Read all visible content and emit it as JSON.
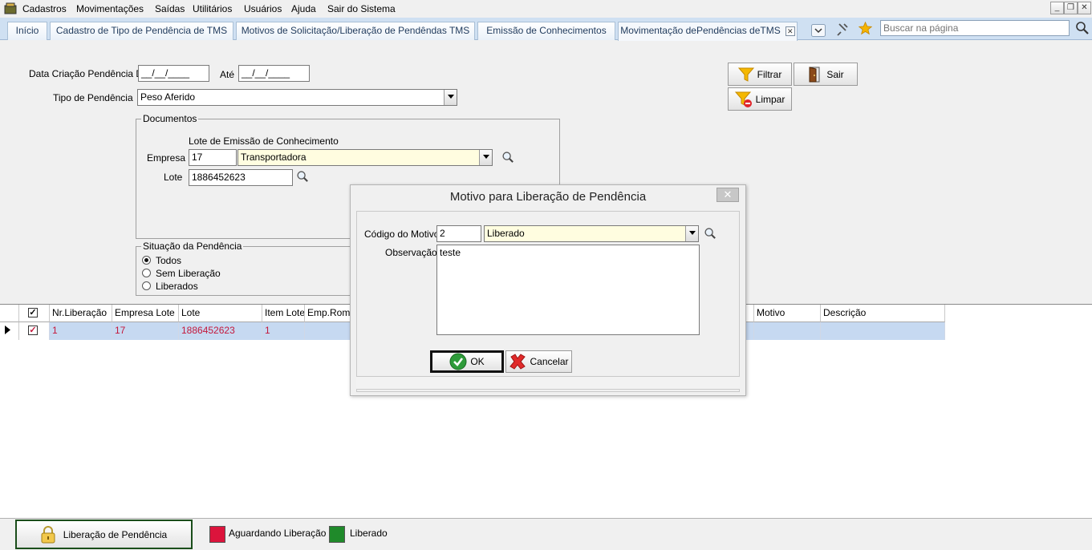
{
  "menu": [
    "Cadastros",
    "Movimentações",
    "Saídas",
    "Utilitários",
    "Usuários",
    "Ajuda",
    "Sair do Sistema"
  ],
  "tabs": [
    {
      "label": "Início"
    },
    {
      "label": "Cadastro de Tipo de Pendência de TMS"
    },
    {
      "label": "Motivos de Solicitação/Liberação de Pendêndas TMS"
    },
    {
      "label": "Emissão de Conhecimentos"
    },
    {
      "label": "Movimentação dePendências deTMS",
      "active": true
    }
  ],
  "search": {
    "placeholder": "Buscar na página"
  },
  "filters": {
    "date_from_label": "Data Criação Pendência De",
    "date_from": "__/__/____",
    "date_to_label": "Até",
    "date_to": "__/__/____",
    "tipo_label": "Tipo de Pendência",
    "tipo_value": "Peso Aferido"
  },
  "documentos": {
    "title": "Documentos",
    "lote_emissao_label": "Lote de Emissão de Conhecimento",
    "empresa_label": "Empresa",
    "empresa_code": "17",
    "empresa_name": "Transportadora",
    "lote_label": "Lote",
    "lote_value": "1886452623"
  },
  "situacao": {
    "title": "Situação da Pendência",
    "options": [
      "Todos",
      "Sem Liberação",
      "Liberados"
    ],
    "selected": "Todos"
  },
  "buttons": {
    "filtrar": "Filtrar",
    "sair": "Sair",
    "limpar": "Limpar"
  },
  "grid": {
    "headers": [
      "Nr.Liberação",
      "Empresa Lote",
      "Lote",
      "Item Lote",
      "Emp.Romar",
      "Motivo",
      "Descrição"
    ],
    "rows": [
      {
        "nr": "1",
        "empresa": "17",
        "lote": "1886452623",
        "item": "1",
        "emp": "",
        "motivo": "",
        "descricao": ""
      }
    ],
    "row_color": "#c4183c"
  },
  "dialog": {
    "title": "Motivo para Liberação de Pendência",
    "codigo_label": "Código do Motivo",
    "codigo_value": "2",
    "motivo_value": "Liberado",
    "obs_label": "Observação",
    "obs_value": "teste",
    "ok": "OK",
    "cancelar": "Cancelar"
  },
  "bottom": {
    "liberacao_button": "Liberação de Pendência",
    "legend": [
      {
        "label": "Aguardando Liberação",
        "color": "#dc143c"
      },
      {
        "label": "Liberado",
        "color": "#1f8a2a"
      }
    ]
  }
}
